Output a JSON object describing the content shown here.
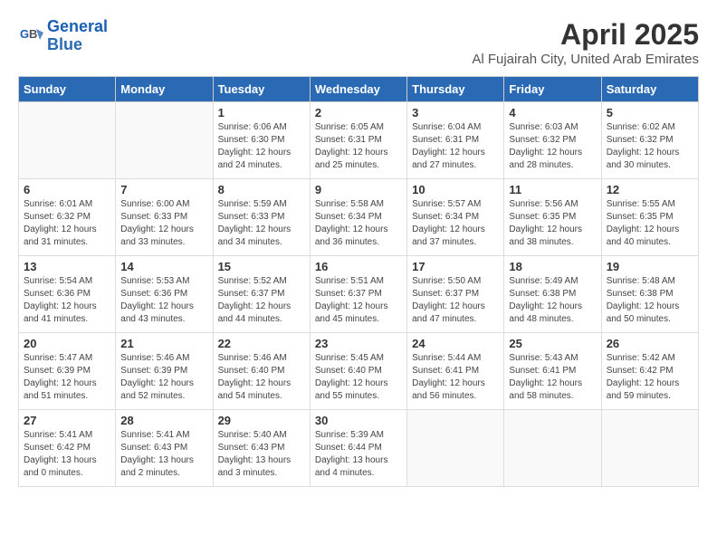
{
  "header": {
    "logo_line1": "General",
    "logo_line2": "Blue",
    "month_title": "April 2025",
    "subtitle": "Al Fujairah City, United Arab Emirates"
  },
  "weekdays": [
    "Sunday",
    "Monday",
    "Tuesday",
    "Wednesday",
    "Thursday",
    "Friday",
    "Saturday"
  ],
  "weeks": [
    [
      {
        "day": "",
        "info": ""
      },
      {
        "day": "",
        "info": ""
      },
      {
        "day": "1",
        "info": "Sunrise: 6:06 AM\nSunset: 6:30 PM\nDaylight: 12 hours and 24 minutes."
      },
      {
        "day": "2",
        "info": "Sunrise: 6:05 AM\nSunset: 6:31 PM\nDaylight: 12 hours and 25 minutes."
      },
      {
        "day": "3",
        "info": "Sunrise: 6:04 AM\nSunset: 6:31 PM\nDaylight: 12 hours and 27 minutes."
      },
      {
        "day": "4",
        "info": "Sunrise: 6:03 AM\nSunset: 6:32 PM\nDaylight: 12 hours and 28 minutes."
      },
      {
        "day": "5",
        "info": "Sunrise: 6:02 AM\nSunset: 6:32 PM\nDaylight: 12 hours and 30 minutes."
      }
    ],
    [
      {
        "day": "6",
        "info": "Sunrise: 6:01 AM\nSunset: 6:32 PM\nDaylight: 12 hours and 31 minutes."
      },
      {
        "day": "7",
        "info": "Sunrise: 6:00 AM\nSunset: 6:33 PM\nDaylight: 12 hours and 33 minutes."
      },
      {
        "day": "8",
        "info": "Sunrise: 5:59 AM\nSunset: 6:33 PM\nDaylight: 12 hours and 34 minutes."
      },
      {
        "day": "9",
        "info": "Sunrise: 5:58 AM\nSunset: 6:34 PM\nDaylight: 12 hours and 36 minutes."
      },
      {
        "day": "10",
        "info": "Sunrise: 5:57 AM\nSunset: 6:34 PM\nDaylight: 12 hours and 37 minutes."
      },
      {
        "day": "11",
        "info": "Sunrise: 5:56 AM\nSunset: 6:35 PM\nDaylight: 12 hours and 38 minutes."
      },
      {
        "day": "12",
        "info": "Sunrise: 5:55 AM\nSunset: 6:35 PM\nDaylight: 12 hours and 40 minutes."
      }
    ],
    [
      {
        "day": "13",
        "info": "Sunrise: 5:54 AM\nSunset: 6:36 PM\nDaylight: 12 hours and 41 minutes."
      },
      {
        "day": "14",
        "info": "Sunrise: 5:53 AM\nSunset: 6:36 PM\nDaylight: 12 hours and 43 minutes."
      },
      {
        "day": "15",
        "info": "Sunrise: 5:52 AM\nSunset: 6:37 PM\nDaylight: 12 hours and 44 minutes."
      },
      {
        "day": "16",
        "info": "Sunrise: 5:51 AM\nSunset: 6:37 PM\nDaylight: 12 hours and 45 minutes."
      },
      {
        "day": "17",
        "info": "Sunrise: 5:50 AM\nSunset: 6:37 PM\nDaylight: 12 hours and 47 minutes."
      },
      {
        "day": "18",
        "info": "Sunrise: 5:49 AM\nSunset: 6:38 PM\nDaylight: 12 hours and 48 minutes."
      },
      {
        "day": "19",
        "info": "Sunrise: 5:48 AM\nSunset: 6:38 PM\nDaylight: 12 hours and 50 minutes."
      }
    ],
    [
      {
        "day": "20",
        "info": "Sunrise: 5:47 AM\nSunset: 6:39 PM\nDaylight: 12 hours and 51 minutes."
      },
      {
        "day": "21",
        "info": "Sunrise: 5:46 AM\nSunset: 6:39 PM\nDaylight: 12 hours and 52 minutes."
      },
      {
        "day": "22",
        "info": "Sunrise: 5:46 AM\nSunset: 6:40 PM\nDaylight: 12 hours and 54 minutes."
      },
      {
        "day": "23",
        "info": "Sunrise: 5:45 AM\nSunset: 6:40 PM\nDaylight: 12 hours and 55 minutes."
      },
      {
        "day": "24",
        "info": "Sunrise: 5:44 AM\nSunset: 6:41 PM\nDaylight: 12 hours and 56 minutes."
      },
      {
        "day": "25",
        "info": "Sunrise: 5:43 AM\nSunset: 6:41 PM\nDaylight: 12 hours and 58 minutes."
      },
      {
        "day": "26",
        "info": "Sunrise: 5:42 AM\nSunset: 6:42 PM\nDaylight: 12 hours and 59 minutes."
      }
    ],
    [
      {
        "day": "27",
        "info": "Sunrise: 5:41 AM\nSunset: 6:42 PM\nDaylight: 13 hours and 0 minutes."
      },
      {
        "day": "28",
        "info": "Sunrise: 5:41 AM\nSunset: 6:43 PM\nDaylight: 13 hours and 2 minutes."
      },
      {
        "day": "29",
        "info": "Sunrise: 5:40 AM\nSunset: 6:43 PM\nDaylight: 13 hours and 3 minutes."
      },
      {
        "day": "30",
        "info": "Sunrise: 5:39 AM\nSunset: 6:44 PM\nDaylight: 13 hours and 4 minutes."
      },
      {
        "day": "",
        "info": ""
      },
      {
        "day": "",
        "info": ""
      },
      {
        "day": "",
        "info": ""
      }
    ]
  ]
}
